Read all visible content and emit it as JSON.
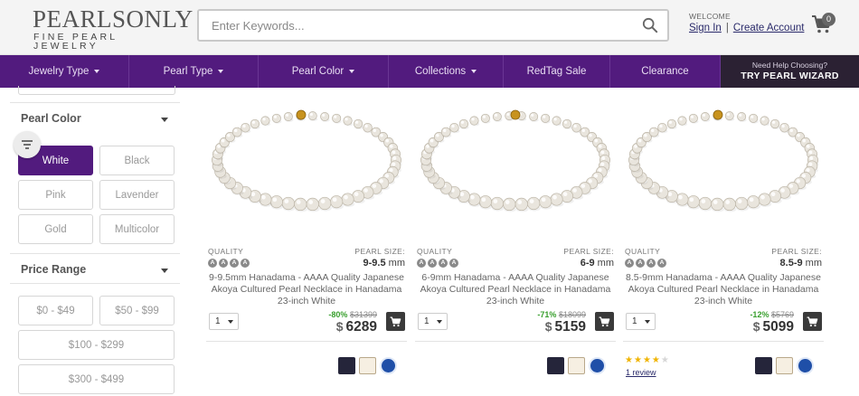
{
  "header": {
    "logo_main": "PEARLSONLY",
    "logo_sub": "FINE PEARL JEWELRY",
    "search_placeholder": "Enter Keywords...",
    "welcome": "WELCOME",
    "sign_in": "Sign In",
    "separator": "|",
    "create_account": "Create Account",
    "cart_count": "0"
  },
  "nav": {
    "items": [
      {
        "label": "Jewelry Type"
      },
      {
        "label": "Pearl Type"
      },
      {
        "label": "Pearl Color"
      },
      {
        "label": "Collections"
      },
      {
        "label": "RedTag Sale"
      },
      {
        "label": "Clearance"
      }
    ],
    "help": "Need Help Choosing?",
    "wizard": "TRY PEARL WIZARD"
  },
  "sidebar": {
    "pearl_color": {
      "title": "Pearl Color",
      "options": [
        "White",
        "Black",
        "Pink",
        "Lavender",
        "Gold",
        "Multicolor"
      ],
      "selected": "White"
    },
    "price_range": {
      "title": "Price Range",
      "options": [
        "$0 - $49",
        "$50 - $99",
        "$100 - $299",
        "$300 - $499"
      ]
    }
  },
  "products": [
    {
      "quality_label": "QUALITY",
      "quality_grade": [
        "A",
        "A",
        "A",
        "A"
      ],
      "size_label": "PEARL SIZE:",
      "size_value": "9-9.5",
      "size_unit": "mm",
      "title": "9-9.5mm Hanadama - AAAA Quality Japanese Akoya Cultured Pearl Necklace in Hanadama 23-inch White",
      "qty": "1",
      "discount": "-80%",
      "old_price": "$31399",
      "currency": "$",
      "price": "6289",
      "clasp_color": "#c8931e"
    },
    {
      "quality_label": "QUALITY",
      "quality_grade": [
        "A",
        "A",
        "A",
        "A"
      ],
      "size_label": "PEARL SIZE:",
      "size_value": "6-9",
      "size_unit": "mm",
      "title": "6-9mm Hanadama - AAAA Quality Japanese Akoya Cultured Pearl Necklace in Hanadama 23-inch White",
      "qty": "1",
      "discount": "-71%",
      "old_price": "$18099",
      "currency": "$",
      "price": "5159",
      "clasp_color": "#c8931e"
    },
    {
      "quality_label": "QUALITY",
      "quality_grade": [
        "A",
        "A",
        "A",
        "A"
      ],
      "size_label": "PEARL SIZE:",
      "size_value": "8.5-9",
      "size_unit": "mm",
      "title": "8.5-9mm Hanadama - AAAA Quality Japanese Akoya Cultured Pearl Necklace in Hanadama 23-inch White",
      "qty": "1",
      "discount": "-12%",
      "old_price": "$5769",
      "currency": "$",
      "price": "5099",
      "clasp_color": "#c8931e",
      "rating": 4,
      "reviews": "1 review"
    }
  ],
  "colors": {
    "brand_purple": "#521b7e",
    "wizard_bg": "#2b2133",
    "discount_green": "#3aa02f"
  }
}
